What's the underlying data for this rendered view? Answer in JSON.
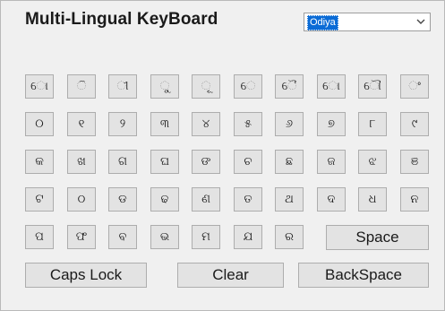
{
  "app": {
    "title": "Multi-Lingual KeyBoard"
  },
  "language_select": {
    "selected": "Odiya"
  },
  "keys": [
    [
      "ୋ",
      "ି",
      "ୀ",
      "ୁ",
      "ୂ",
      "େ",
      "ୈ",
      "ୋ",
      "ୌ",
      "ଂ"
    ],
    [
      "୦",
      "୧",
      "୨",
      "୩",
      "୪",
      "୫",
      "୬",
      "୭",
      "୮",
      "୯"
    ],
    [
      "କ",
      "ଖ",
      "ଗ",
      "ଘ",
      "ଙ",
      "ଚ",
      "ଛ",
      "ଜ",
      "ଝ",
      "ଞ"
    ],
    [
      "ଟ",
      "ଠ",
      "ଡ",
      "ଢ",
      "ଣ",
      "ତ",
      "ଥ",
      "ଦ",
      "ଧ",
      "ନ"
    ],
    [
      "ପ",
      "ଫ",
      "ବ",
      "ଭ",
      "ମ",
      "ଯ",
      "ର"
    ]
  ],
  "buttons": {
    "space": "Space",
    "caps_lock": "Caps Lock",
    "clear": "Clear",
    "backspace": "BackSpace"
  }
}
